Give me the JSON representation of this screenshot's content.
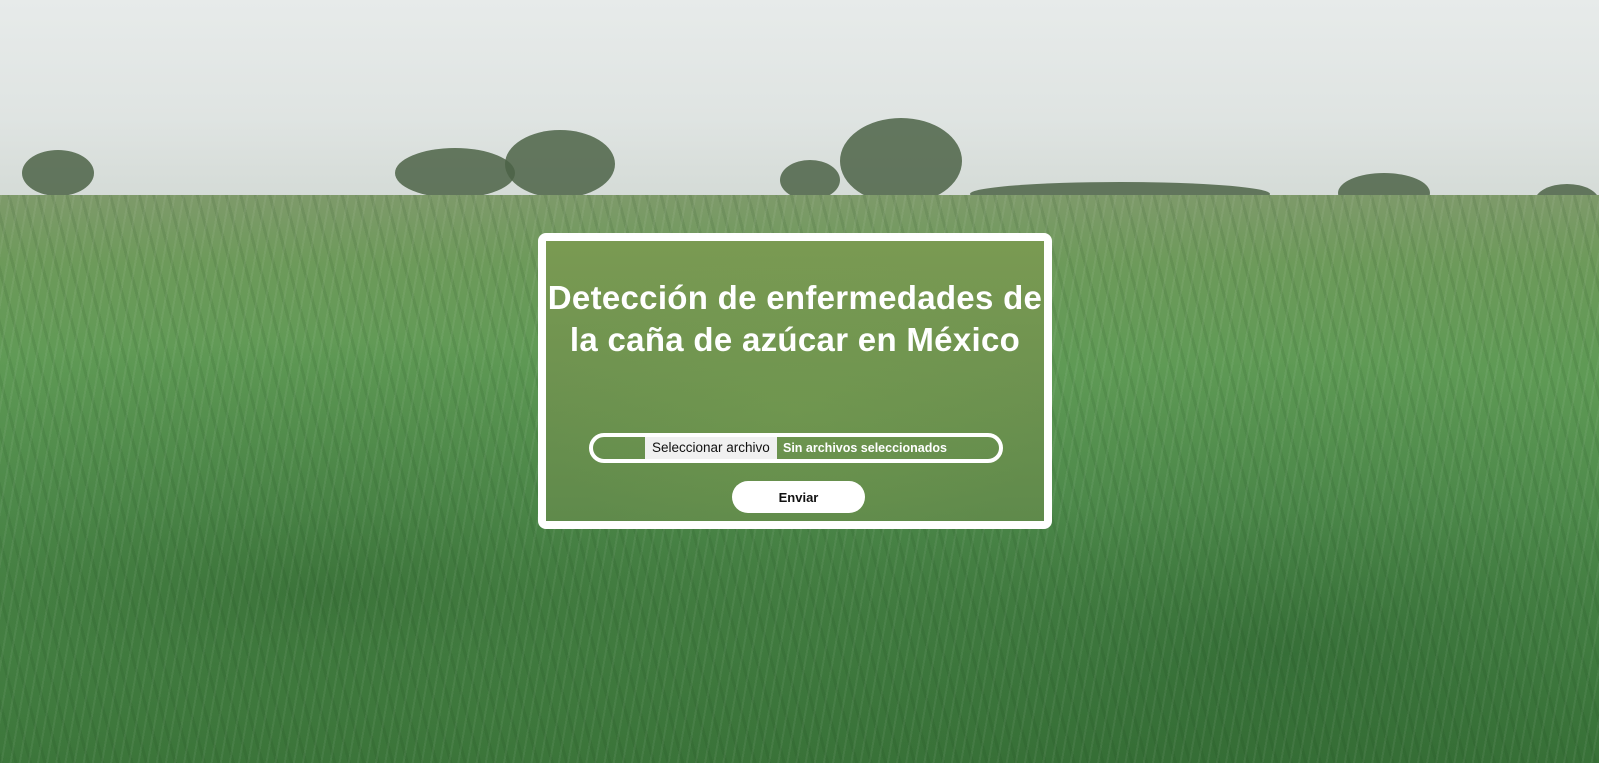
{
  "form": {
    "title": "Detección de enfermedades de la caña de azúcar en México",
    "file_button_label": "Seleccionar archivo",
    "file_status": "Sin archivos seleccionados",
    "submit_label": "Enviar"
  },
  "colors": {
    "card_border": "#ffffff",
    "card_background": "#6f9350",
    "title_text": "#ffffff",
    "button_background": "#ffffff"
  }
}
